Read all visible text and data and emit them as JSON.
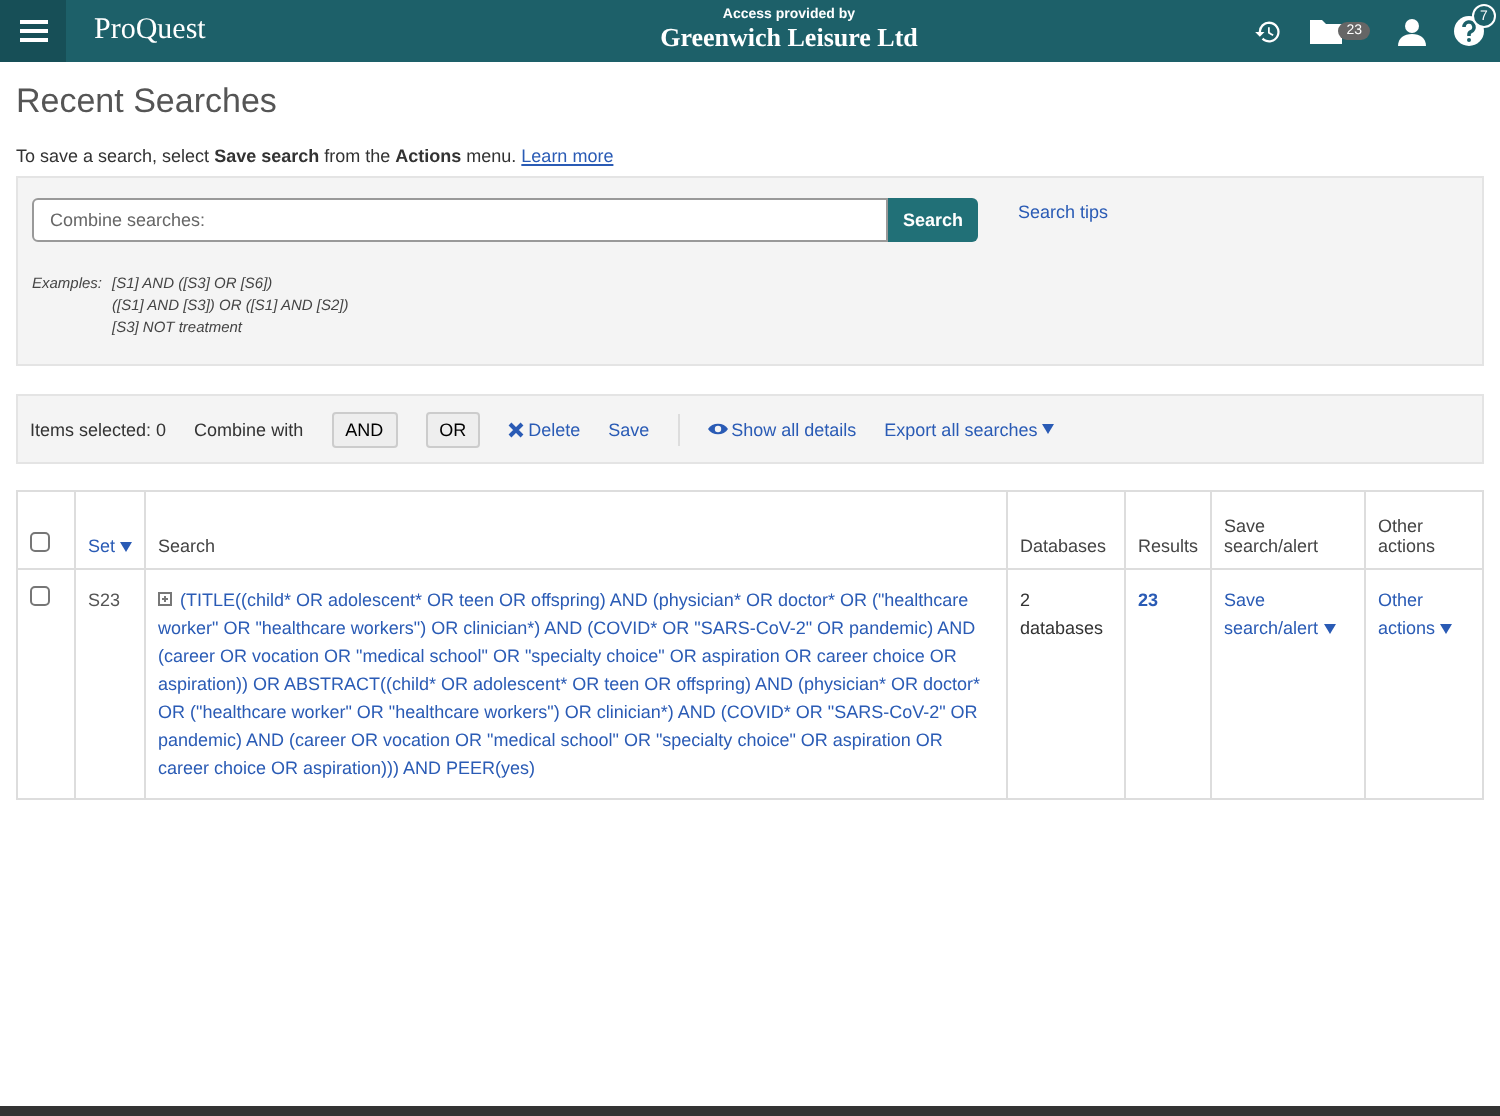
{
  "header": {
    "logo": "ProQuest",
    "access_label": "Access provided by",
    "institution": "Greenwich Leisure Ltd",
    "folder_count": "23",
    "help_count": "7"
  },
  "page_title": "Recent Searches",
  "intro": {
    "text": "To save a search, select **Save search** from the **Actions** menu.",
    "link": "Learn more"
  },
  "combine_panel": {
    "placeholder": "Combine searches:",
    "button": "Search",
    "tips_link": "Search tips",
    "examples_label": "Examples:",
    "examples": [
      "[S1] AND ([S3] OR [S6])",
      "([S1] AND [S3]) OR ([S1] AND [S2])",
      "[S3] NOT treatment"
    ]
  },
  "actions_bar": {
    "items_selected": "Items selected: 0",
    "combine_with": "Combine with",
    "operators": [
      "AND",
      "OR"
    ],
    "delete": "Delete",
    "save": "Save",
    "show_details": "Show all details",
    "export": "Export all searches"
  },
  "table": {
    "select_all_checked": false,
    "columns": [
      "Set",
      "Search",
      "Databases",
      "Results",
      "Save search/alert",
      "Other actions"
    ],
    "rows": [
      {
        "checked": false,
        "set": "S23",
        "search": "(TITLE((child* OR adolescent* OR teen OR offspring) AND (physician* OR doctor* OR (\"healthcare worker\" OR \"healthcare workers\") OR clinician*) AND (COVID* OR \"SARS-CoV-2\" OR pandemic) AND (career OR vocation OR \"medical school\" OR \"specialty choice\" OR aspiration OR career choice OR aspiration)) OR ABSTRACT((child* OR adolescent* OR teen OR offspring) AND (physician* OR doctor* OR (\"healthcare worker\" OR \"healthcare workers\") OR clinician*) AND (COVID* OR \"SARS-CoV-2\" OR pandemic) AND (career OR vocation OR \"medical school\" OR \"specialty choice\" OR aspiration OR career choice OR aspiration))) AND PEER(yes)",
        "databases": "2 databases",
        "results": "23",
        "save_action": "Save search/alert",
        "other_action": "Other actions"
      }
    ]
  }
}
